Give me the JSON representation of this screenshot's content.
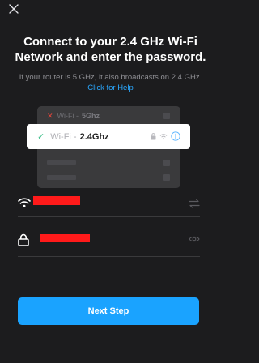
{
  "header": {
    "close_icon": "close-icon"
  },
  "title": "Connect to your 2.4 GHz Wi-Fi Network and enter the password.",
  "subtitle": {
    "text": "If your router is 5 GHz, it also broadcasts on 2.4 GHz.",
    "help_link": "Click for Help"
  },
  "illustration": {
    "row_5ghz": {
      "prefix": "Wi-Fi -",
      "band": "5Ghz"
    },
    "card": {
      "prefix": "Wi-Fi -",
      "band": "2.4Ghz"
    }
  },
  "form": {
    "network_icon": "wifi-icon",
    "network_action_icon": "swap-icon",
    "password_icon": "lock-icon",
    "password_action_icon": "eye-icon"
  },
  "footer": {
    "next_label": "Next Step"
  },
  "colors": {
    "background": "#1c1c1e",
    "accent": "#1aa3ff",
    "link": "#2aa8ff",
    "check": "#3dbf8a",
    "error_x": "#e5453b",
    "redaction": "#ff1a1a"
  }
}
